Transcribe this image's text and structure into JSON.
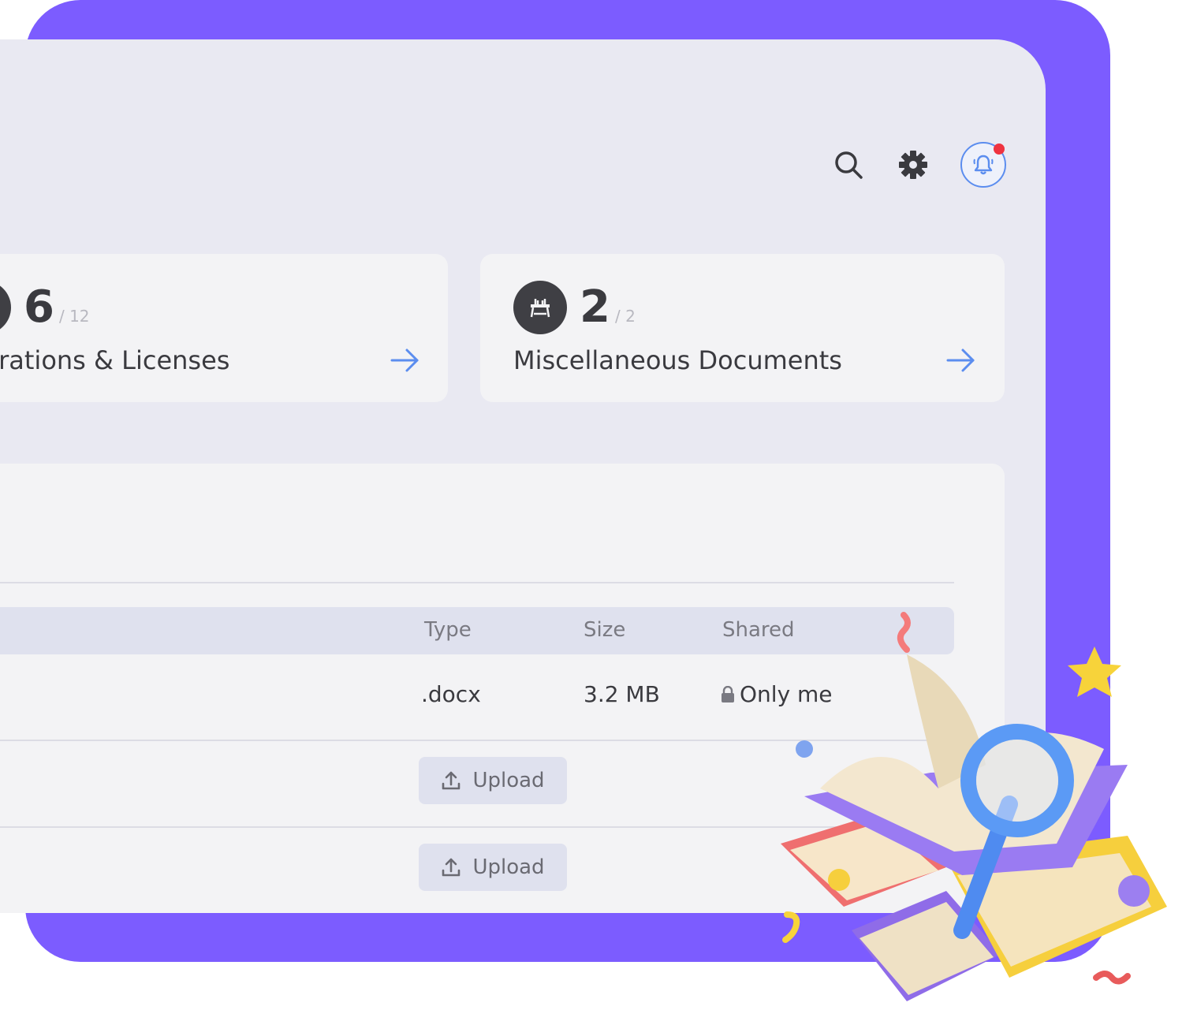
{
  "toolbar": {
    "search_icon": "search-icon",
    "settings_icon": "gear-icon",
    "notifications_icon": "bell-icon",
    "has_unread_notifications": true
  },
  "cards": [
    {
      "count": "6",
      "total": "/ 12",
      "title": "istrations & Licenses",
      "icon": "badge-icon"
    },
    {
      "count": "2",
      "total": "/ 2",
      "title": "Miscellaneous Documents",
      "icon": "table-icon"
    }
  ],
  "table": {
    "headers": {
      "type": "Type",
      "size": "Size",
      "shared": "Shared"
    },
    "rows": [
      {
        "type": ".docx",
        "size": "3.2 MB",
        "shared": "Only me"
      },
      {
        "upload_label": "Upload"
      },
      {
        "upload_label": "Upload"
      }
    ]
  },
  "colors": {
    "frame": "#7c5cff",
    "accent": "#5b8def",
    "notification": "#ef3340"
  }
}
